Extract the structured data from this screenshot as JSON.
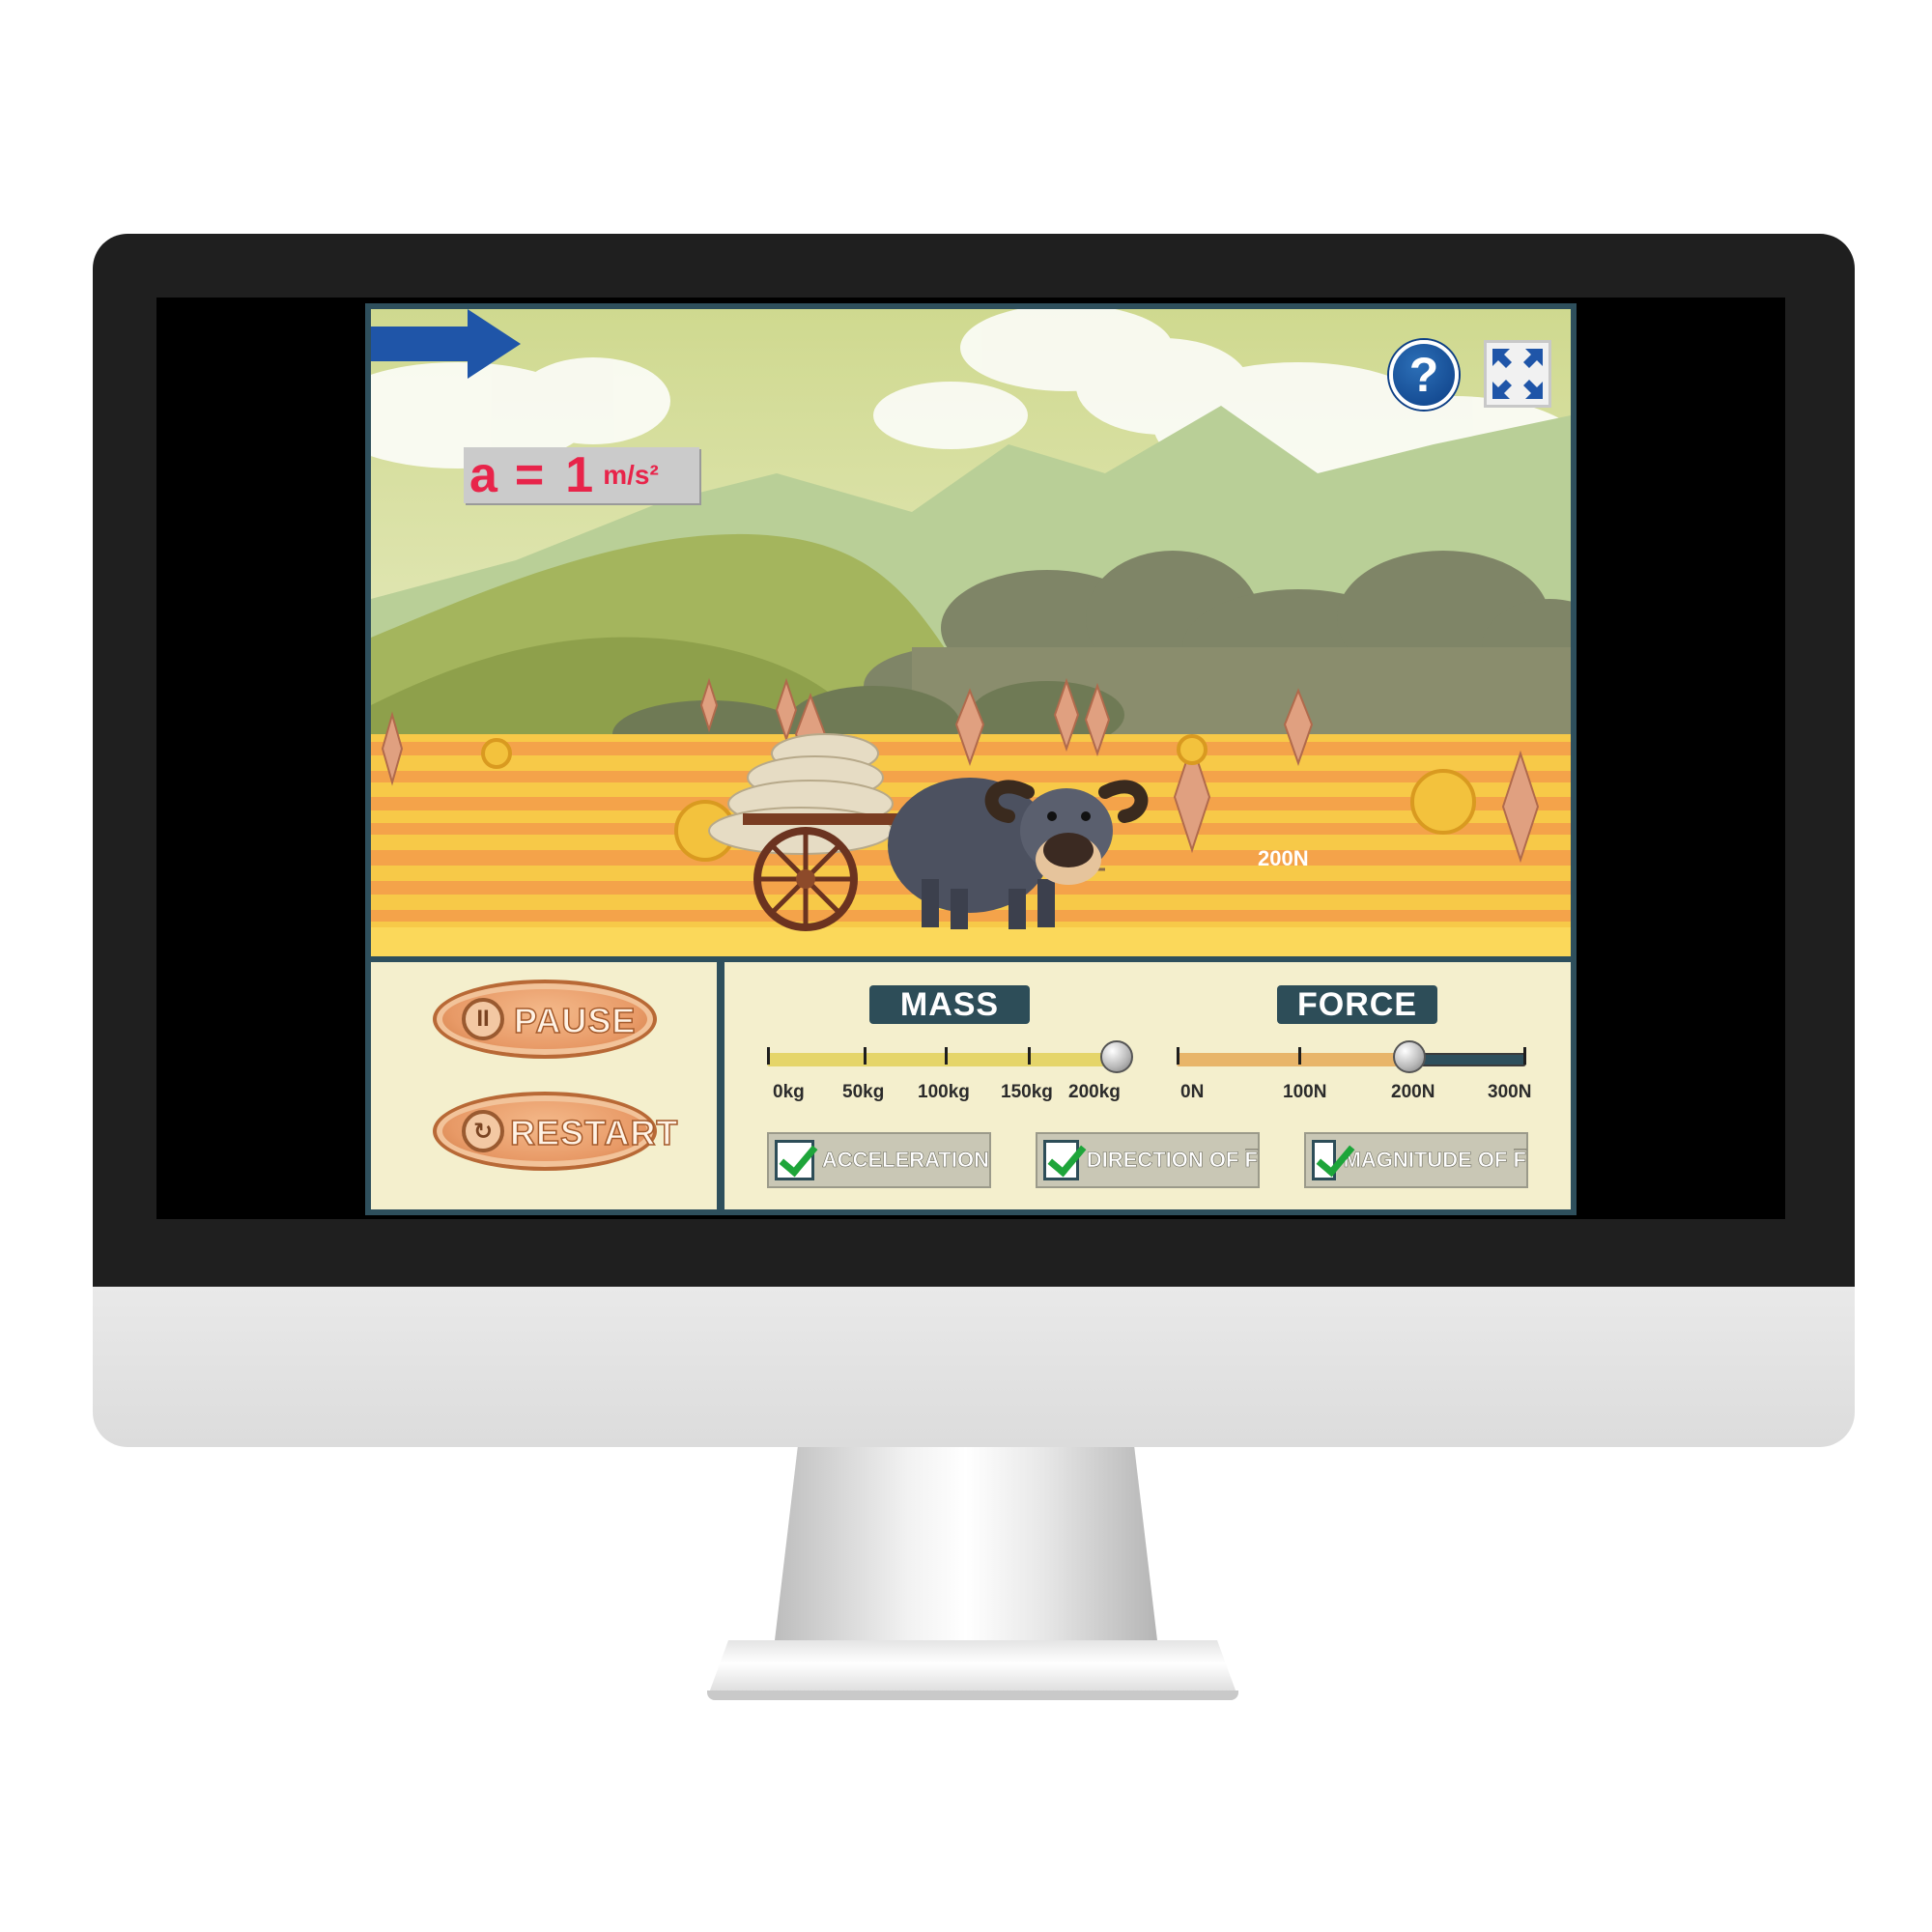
{
  "scene": {
    "acceleration": {
      "symbol": "a",
      "equals": "=",
      "value": "1",
      "unit": "m/s²"
    },
    "help_label": "?",
    "force_arrow_label": "200N"
  },
  "controls": {
    "pause_label": "PAUSE",
    "restart_label": "RESTART",
    "mass": {
      "title": "MASS",
      "ticks": [
        "0kg",
        "50kg",
        "100kg",
        "150kg",
        "200kg"
      ],
      "value_fraction": 1.0
    },
    "force": {
      "title": "FORCE",
      "ticks": [
        "0N",
        "100N",
        "200N",
        "300N"
      ],
      "value_fraction": 0.667
    },
    "checkboxes": [
      {
        "label": "ACCELERATION",
        "checked": true
      },
      {
        "label": "DIRECTION OF F̅",
        "checked": true
      },
      {
        "label": "MAGNITUDE OF F̅",
        "checked": true
      }
    ]
  },
  "colors": {
    "accent_red": "#e8244a",
    "panel_bg": "#f4efcd",
    "frame": "#2e4f5c",
    "arrow_blue": "#1f55a8"
  }
}
